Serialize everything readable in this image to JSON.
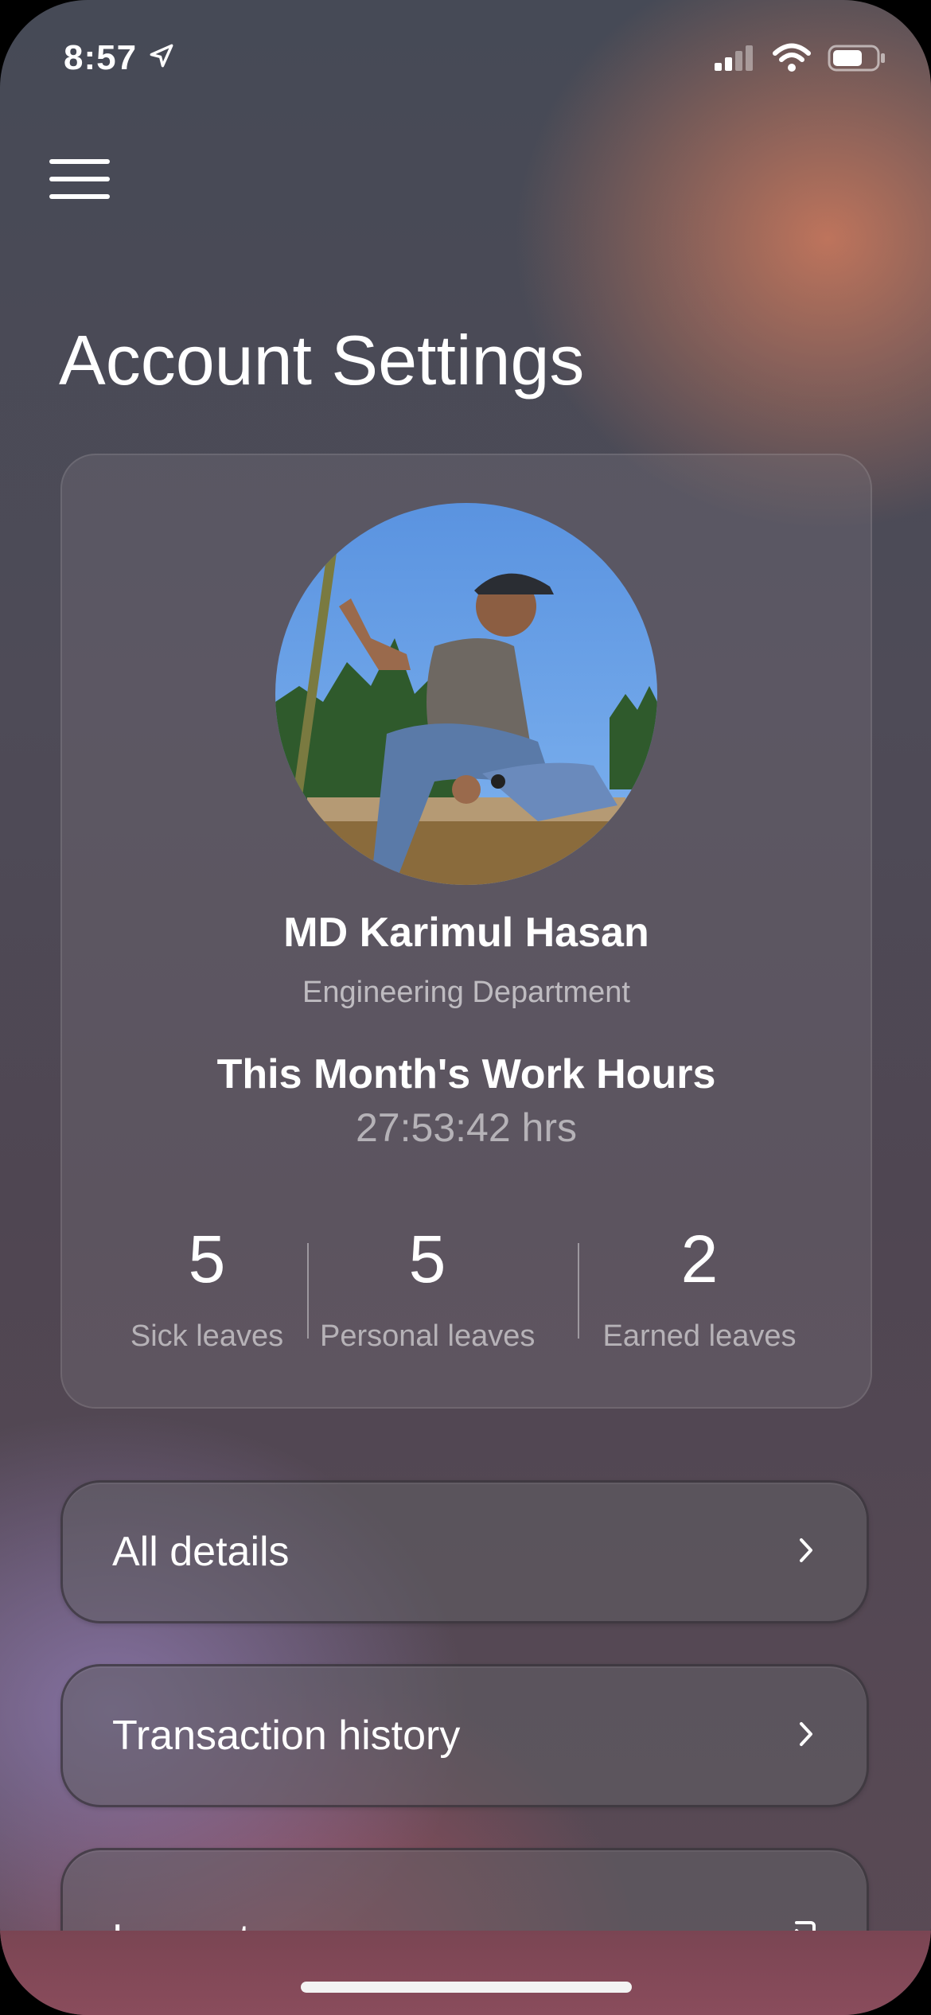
{
  "status_bar": {
    "time": "8:57"
  },
  "header": {
    "title": "Account Settings"
  },
  "profile": {
    "name": "MD Karimul Hasan",
    "department": "Engineering Department",
    "hours_title": "This Month's Work Hours",
    "hours_value": "27:53:42 hrs"
  },
  "leaves": [
    {
      "count": "5",
      "label": "Sick leaves"
    },
    {
      "count": "5",
      "label": "Personal leaves"
    },
    {
      "count": "2",
      "label": "Earned leaves"
    }
  ],
  "menu": {
    "all_details": "All details",
    "transaction_history": "Transaction history",
    "log_out": "Log out"
  },
  "colors": {
    "accent_warm": "#c4765c",
    "accent_violet": "#8a76aa",
    "text_primary": "#ffffff"
  }
}
